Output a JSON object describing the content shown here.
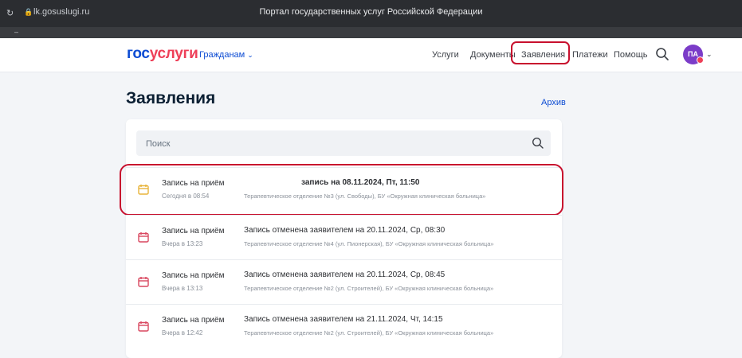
{
  "browser": {
    "url": "lk.gosuslugi.ru",
    "tab_title": "Портал государственных услуг Российской Федерации"
  },
  "header": {
    "logo_part1": "гос",
    "logo_part2": "услуги",
    "citizens": "Гражданам",
    "nav": {
      "services": "Услуги",
      "documents": "Документы",
      "applications": "Заявления",
      "payments": "Платежи",
      "help": "Помощь"
    },
    "avatar_initials": "ПА"
  },
  "main": {
    "title": "Заявления",
    "archive": "Архив",
    "search_placeholder": "Поиск"
  },
  "applications": [
    {
      "type": "Запись на приём",
      "time": "Сегодня в 08:54",
      "status": "запись на 08.11.2024, Пт, 11:50",
      "place": "Терапевтическое отделение №3 (ул. Свободы), БУ «Окружная клиническая больница»",
      "icon_color": "#e8b43a"
    },
    {
      "type": "Запись на приём",
      "time": "Вчера в 13:23",
      "status": "Запись отменена заявителем на 20.11.2024, Ср, 08:30",
      "place": "Терапевтическое отделение №4 (ул. Пионерская), БУ «Окружная клиническая больница»",
      "icon_color": "#d9475f"
    },
    {
      "type": "Запись на приём",
      "time": "Вчера в 13:13",
      "status": "Запись отменена заявителем на 20.11.2024, Ср, 08:45",
      "place": "Терапевтическое отделение №2 (ул. Строителей), БУ «Окружная клиническая больница»",
      "icon_color": "#d9475f"
    },
    {
      "type": "Запись на приём",
      "time": "Вчера в 12:42",
      "status": "Запись отменена заявителем на 21.11.2024, Чт, 14:15",
      "place": "Терапевтическое отделение №2 (ул. Строителей), БУ «Окружная клиническая больница»",
      "icon_color": "#d9475f"
    }
  ],
  "colors": {
    "brand_blue": "#0d4cd3",
    "brand_red": "#ee3f58",
    "highlight": "#c8102e"
  }
}
